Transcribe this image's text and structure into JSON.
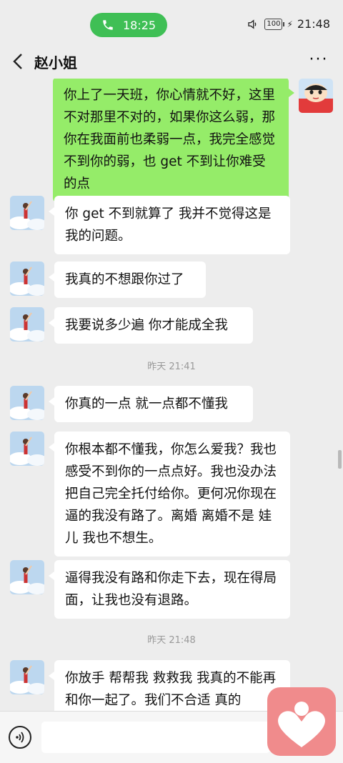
{
  "status_bar": {
    "call_time": "18:25",
    "battery": "100",
    "clock": "21:48"
  },
  "header": {
    "title": "赵小姐",
    "more_label": "···"
  },
  "messages": {
    "m0": "你上了一天班，你心情就不好，这里不对那里不对的，如果你这么弱，那你在我面前也柔弱一点，我完全感觉不到你的弱，也 get 不到让你难受的点",
    "m1": "你 get 不到就算了 我并不觉得这是我的问题。",
    "m2": "我真的不想跟你过了",
    "m3": "我要说多少遍 你才能成全我",
    "t1": "昨天 21:41",
    "m4": "你真的一点 就一点都不懂我",
    "m5": "你根本都不懂我，你怎么爱我？我也感受不到你的一点点好。我也没办法把自己完全托付给你。更何况你现在逼的我没有路了。离婚 离婚不是 娃儿 我也不想生。",
    "m6": "逼得我没有路和你走下去，现在得局面，让我也没有退路。",
    "t2": "昨天 21:48",
    "m7": "你放手 帮帮我 救救我 我真的不能再和你一起了。我们不合适 真的"
  },
  "colors": {
    "outgoing_bubble": "#95ec69",
    "incoming_bubble": "#ffffff",
    "call_pill": "#3fbf55",
    "background": "#ededed",
    "floating_app": "#f08b8c"
  },
  "icons": [
    "phone-icon",
    "volume-icon",
    "battery-icon",
    "back-icon",
    "more-icon",
    "voice-icon",
    "heart-app-icon"
  ]
}
